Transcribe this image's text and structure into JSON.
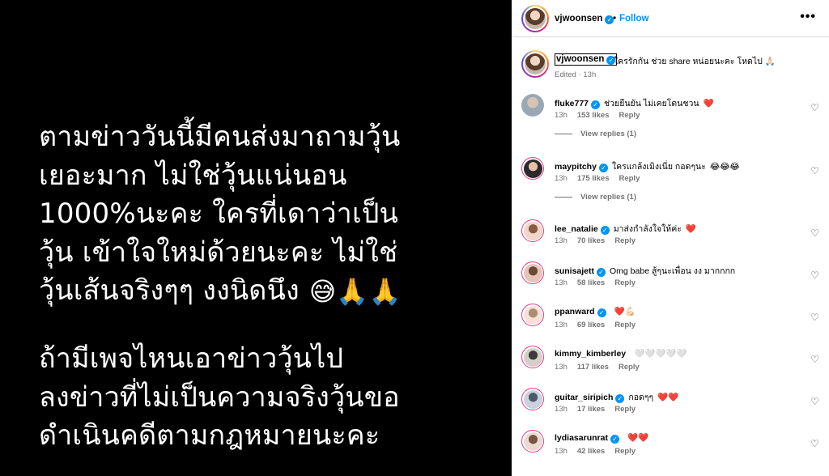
{
  "post_image": {
    "paragraph1": [
      "ตามข่าววันนี้มีคนส่งมาถามวุ้น",
      "เยอะมาก ไม่ใช่วุ้นแน่นอน",
      "1000%นะคะ ใครที่เดาว่าเป็น",
      "วุ้น  เข้าใจใหม่ด้วยนะคะ ไม่ใช่",
      "วุ้นเส้นจริงๆๆ งงนิดนึง"
    ],
    "emoji": "😅🙏🙏",
    "paragraph2": [
      "ถ้ามีเพจไหนเอาข่าววุ้นไป",
      "ลงข่าวที่ไม่เป็นความจริงวุ้นขอ",
      "ดำเนินคดีตามกฎหมายนะคะ"
    ]
  },
  "header": {
    "username": "vjwoonsen",
    "dot": "•",
    "follow_label": "Follow",
    "more_icon": "more-horizontal-icon",
    "more_glyph": "•••"
  },
  "caption": {
    "username": "vjwoonsen",
    "text": "ใครรักกัน ช่วย share หน่อยนะคะ โหดไป 🙏🏻",
    "meta": "Edited · 13h"
  },
  "comments": [
    {
      "user": "fluke777",
      "verified": true,
      "text": "ช่วยยืนยัน ไม่เคยโดนชวน",
      "emoji": "❤️",
      "time": "13h",
      "likes": "153 likes",
      "reply": "Reply",
      "view_replies": "View replies (1)"
    },
    {
      "user": "maypitchy",
      "verified": true,
      "text": "ใครแกล้งเมิงเนี่ย กอดๆนะ",
      "emoji": "😂😂😂",
      "time": "13h",
      "likes": "175 likes",
      "reply": "Reply",
      "view_replies": "View replies (1)"
    },
    {
      "user": "lee_natalie",
      "verified": true,
      "text": "มาส่งกำลังใจให้ค่ะ",
      "emoji": "❤️",
      "time": "13h",
      "likes": "70 likes",
      "reply": "Reply"
    },
    {
      "user": "sunisajett",
      "verified": true,
      "text": "Omg babe สู้ๆนะเพื่อน งง มากกกก",
      "emoji": "",
      "time": "13h",
      "likes": "58 likes",
      "reply": "Reply"
    },
    {
      "user": "ppanward",
      "verified": true,
      "text": "",
      "emoji": "❤️💪🏻",
      "time": "13h",
      "likes": "69 likes",
      "reply": "Reply"
    },
    {
      "user": "kimmy_kimberley",
      "verified": false,
      "text": "",
      "emoji": "🤍🤍🤍🤍🤍",
      "time": "13h",
      "likes": "117 likes",
      "reply": "Reply"
    },
    {
      "user": "guitar_siripich",
      "verified": true,
      "text": "กอดๆๆ",
      "emoji": "❤️❤️",
      "time": "13h",
      "likes": "17 likes",
      "reply": "Reply"
    },
    {
      "user": "lydiasarunrat",
      "verified": true,
      "text": "",
      "emoji": "❤️❤️",
      "time": "13h",
      "likes": "42 likes",
      "reply": "Reply"
    }
  ],
  "icons": {
    "heart": "heart-outline-icon",
    "verified": "verified-badge-icon"
  },
  "colors": {
    "accent": "#0095f6",
    "muted": "#737373",
    "heart": "#ff3040",
    "image_bg": "#000000"
  }
}
